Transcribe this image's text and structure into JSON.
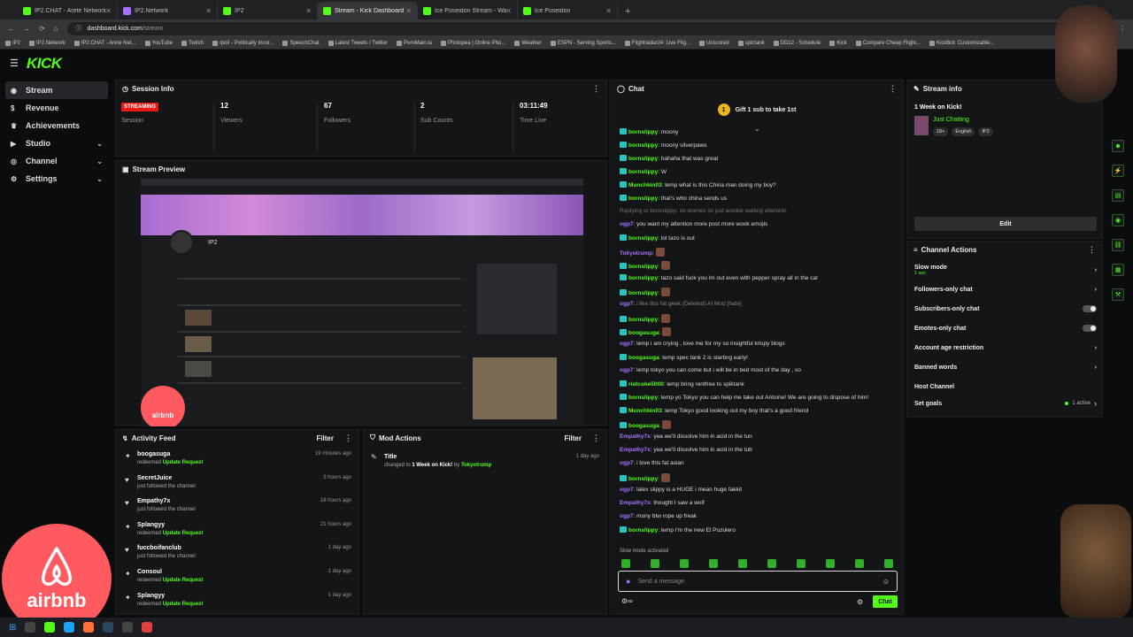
{
  "browser": {
    "tabs": [
      {
        "label": "IP2.CHAT - Arete Network",
        "active": false
      },
      {
        "label": "IP2.Network",
        "active": false
      },
      {
        "label": "IP2",
        "active": false
      },
      {
        "label": "Stream - Kick Dashboard",
        "active": true
      },
      {
        "label": "Ice Poseidon Stream - Wa",
        "active": false
      },
      {
        "label": "Ice Poseidon",
        "active": false
      }
    ],
    "url_host": "dashboard.kick.com",
    "url_path": "/stream",
    "bookmarks": [
      "IP2",
      "IP2.Network",
      "IP2.CHAT - Arete Net...",
      "YouTube",
      "Twitch",
      "/pol/ - Politically Incor...",
      "SpeechChat",
      "Latest Tweets / Twitter",
      "PornMain.la",
      "Photopea | Online Pho...",
      "Weather",
      "ESPN - Serving Sports...",
      "Flightradar24: Live Flig...",
      "Unscored",
      "spictank",
      "DD12 - Schedule",
      "Kick",
      "Compare Cheap Flight...",
      "KickBot: Customizable..."
    ]
  },
  "logo": "KICK",
  "nav": [
    {
      "label": "Stream",
      "icon": "broadcast-icon",
      "active": true,
      "expand": false
    },
    {
      "label": "Revenue",
      "icon": "dollar-icon",
      "active": false,
      "expand": false
    },
    {
      "label": "Achievements",
      "icon": "trophy-icon",
      "active": false,
      "expand": false
    },
    {
      "label": "Studio",
      "icon": "studio-icon",
      "active": false,
      "expand": true
    },
    {
      "label": "Channel",
      "icon": "channel-icon",
      "active": false,
      "expand": true
    },
    {
      "label": "Settings",
      "icon": "gear-icon",
      "active": false,
      "expand": true
    }
  ],
  "session": {
    "title": "Session Info",
    "status": "STREAMING",
    "status_label": "Session",
    "stats": [
      {
        "value": "12",
        "label": "Viewers"
      },
      {
        "value": "67",
        "label": "Followers"
      },
      {
        "value": "2",
        "label": "Sub Counts"
      },
      {
        "value": "03:11:49",
        "label": "Time Live"
      }
    ]
  },
  "preview": {
    "title": "Stream Preview",
    "channel": "IP2",
    "watermark": "airbnb"
  },
  "activity": {
    "title": "Activity Feed",
    "filter": "Filter",
    "items": [
      {
        "name": "boogasuga",
        "pre": "redeemed ",
        "hl": "Update Request",
        "time": "19 minutes ago",
        "icon": "gift-icon"
      },
      {
        "name": "SecretJuice",
        "pre": "just followed the channel",
        "hl": "",
        "time": "3 hours ago",
        "icon": "heart-icon"
      },
      {
        "name": "Empathy7x",
        "pre": "just followed the channel",
        "hl": "",
        "time": "18 hours ago",
        "icon": "heart-icon"
      },
      {
        "name": "Splangyy",
        "pre": "redeemed ",
        "hl": "Update Request",
        "time": "21 hours ago",
        "icon": "gift-icon"
      },
      {
        "name": "fuccboifanclub",
        "pre": "just followed the channel",
        "hl": "",
        "time": "1 day ago",
        "icon": "heart-icon"
      },
      {
        "name": "Consoul",
        "pre": "redeemed ",
        "hl": "Update Request",
        "time": "1 day ago",
        "icon": "gift-icon"
      },
      {
        "name": "Splangyy",
        "pre": "redeemed ",
        "hl": "Update Request",
        "time": "1 day ago",
        "icon": "gift-icon"
      }
    ]
  },
  "mod": {
    "title": "Mod Actions",
    "filter": "Filter",
    "item": {
      "title": "Title",
      "pre": "changed to ",
      "hl": "1 Week on Kick!",
      "mid": " by ",
      "user": "Tokyotrump",
      "time": "1 day ago"
    }
  },
  "chat": {
    "title": "Chat",
    "gift_banner": "Gift 1 sub to take 1st",
    "messages": [
      {
        "u": "bornslippy",
        "t": "moony",
        "v": false
      },
      {
        "u": "bornslippy",
        "t": "moony silverpaws",
        "v": false
      },
      {
        "u": "bornslippy",
        "t": "hahaha that was great",
        "v": false
      },
      {
        "u": "bornslippy",
        "t": "W",
        "v": false
      },
      {
        "u": "Munchkin03",
        "t": "lemp what is this China man doing my boy?",
        "v": false
      },
      {
        "u": "bornslippy",
        "t": "that's who china sends us",
        "v": false
      },
      {
        "u": "",
        "t": "Replying to bornslippy: no worries lol just wookie waiting attention",
        "v": false,
        "reply": true
      },
      {
        "u": "ogp7",
        "t": "you want my attention more post more wook emojis",
        "v": true
      },
      {
        "u": "bornslippy",
        "t": "lol tazo is out",
        "v": false
      },
      {
        "u": "Tokyotrump",
        "t": "",
        "v": true
      },
      {
        "u": "bornslippy",
        "t": "",
        "v": false
      },
      {
        "u": "bornslippy",
        "t": "tazo said fuck you im out even with pepper spray all in the car",
        "v": false
      },
      {
        "u": "bornslippy",
        "t": "",
        "v": false
      },
      {
        "u": "ogp7",
        "t": "i like this fat geek (Deleted) AI Mod [hate]",
        "v": true,
        "deleted": true
      },
      {
        "u": "bornslippy",
        "t": "",
        "v": false
      },
      {
        "u": "boogasuga",
        "t": "",
        "v": false
      },
      {
        "u": "ogp7",
        "t": "lemp i am crying , love me for my so insightful krispy blogs",
        "v": true
      },
      {
        "u": "boogasuga",
        "t": "lemp spec tank 2 is starting early!",
        "v": false
      },
      {
        "u": "ogp7",
        "t": "lemp tokyo you can come but i will be in bed most of the day , so",
        "v": true
      },
      {
        "u": "riotcoke5000",
        "t": "lemp bring rentfree to spiktank",
        "v": false
      },
      {
        "u": "bornslippy",
        "t": "lemp yo Tokyo you can help me take out Antoine! We are going to dispose of him!",
        "v": false
      },
      {
        "u": "Munchkin03",
        "t": "lemp Tokyo good looking out my boy that's a good friend",
        "v": false
      },
      {
        "u": "boogasuga",
        "t": "",
        "v": false
      },
      {
        "u": "Empathy7x",
        "t": "yea we'll dissolve him in acid in the tun",
        "v": true
      },
      {
        "u": "Empathy7x",
        "t": "yea we'll dissolve him in acid in the tub",
        "v": true
      },
      {
        "u": "ogp7",
        "t": "i love this fat asian",
        "v": true
      },
      {
        "u": "bornslippy",
        "t": "",
        "v": false
      },
      {
        "u": "ogp7",
        "t": "lalex slippy is a HUGE i mean huge fakkit",
        "v": true
      },
      {
        "u": "Empathy7x",
        "t": "thought I saw a wolf",
        "v": true
      },
      {
        "u": "ogp7",
        "t": "mony btw rope up freak",
        "v": true
      },
      {
        "u": "bornslippy",
        "t": "lemp I'm the new El Pozolero",
        "v": false
      }
    ],
    "slow_mode": "Slow mode activated",
    "input_placeholder": "Send a message",
    "send": "Chat"
  },
  "stream_info": {
    "title": "Stream info",
    "stream_title": "1 Week on Kick!",
    "category": "Just Chatting",
    "tags": [
      "18+",
      "English",
      "IP2"
    ],
    "edit": "Edit"
  },
  "channel_actions": {
    "title": "Channel Actions",
    "items": [
      {
        "label": "Slow mode",
        "sub": "1 sec",
        "ctrl": "chevron"
      },
      {
        "label": "Followers-only chat",
        "sub": "",
        "ctrl": "chevron"
      },
      {
        "label": "Subscribers-only chat",
        "sub": "",
        "ctrl": "toggle"
      },
      {
        "label": "Emotes-only chat",
        "sub": "",
        "ctrl": "toggle"
      },
      {
        "label": "Account age restriction",
        "sub": "",
        "ctrl": "chevron"
      },
      {
        "label": "Banned words",
        "sub": "",
        "ctrl": "chevron"
      },
      {
        "label": "Host Channel",
        "sub": "",
        "ctrl": "none"
      },
      {
        "label": "Set goals",
        "sub": "",
        "ctrl": "active",
        "extra": "1 active"
      }
    ]
  },
  "overlay": {
    "airbnb": "airbnb"
  },
  "colors": {
    "accent": "#53fc18",
    "live": "#e91916",
    "vip": "#a970ff"
  }
}
